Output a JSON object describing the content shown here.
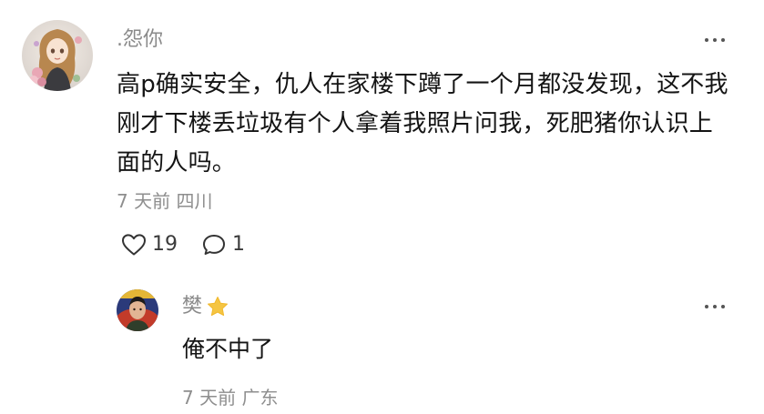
{
  "comment": {
    "username": ".怨你",
    "text": "高p确实安全，仇人在家楼下蹲了一个月都没发现，这不我刚才下楼丢垃圾有个人拿着我照片问我，死肥猪你认识上面的人吗。",
    "meta": "7 天前 四川",
    "likes": "19",
    "replies": "1",
    "avatar_icon": "anime-girl-avatar",
    "more_icon": "more-dots-icon"
  },
  "reply": {
    "username": "樊",
    "badge_icon": "star-icon",
    "badge_color": "#f5c542",
    "text": "俺不中了",
    "meta": "7 天前 广东",
    "avatar_icon": "man-portrait-avatar",
    "more_icon": "more-dots-icon"
  },
  "colors": {
    "muted_text": "#8a8a8a",
    "body_text": "#141414",
    "icon_stroke": "#333333"
  }
}
